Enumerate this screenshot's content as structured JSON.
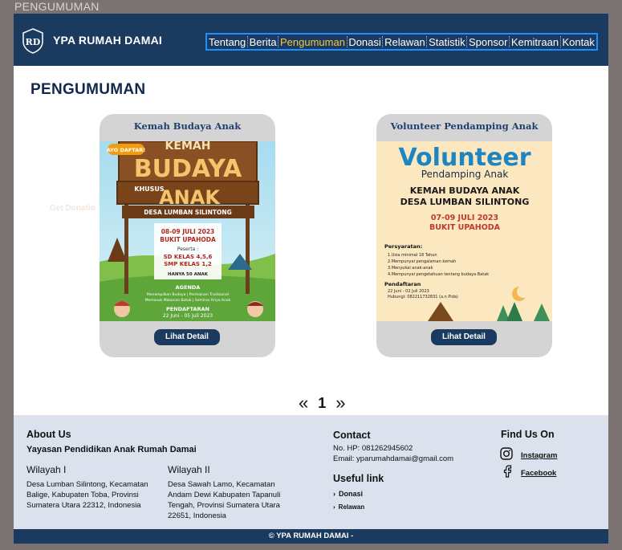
{
  "browser": {
    "tab_title": "PENGUMUMAN"
  },
  "header": {
    "brand": "YPA RUMAH DAMAI",
    "nav": [
      "Tentang",
      "Berita",
      "Pengumuman",
      "Donasi",
      "Relawan",
      "Statistik",
      "Sponsor",
      "Kemitraan",
      "Kontak"
    ],
    "active_nav": "Pengumuman"
  },
  "main": {
    "page_title": "PENGUMUMAN",
    "ghost_text": "Get Donatio",
    "cards": [
      {
        "title": "Kemah Budaya Anak",
        "button": "Lihat Detail",
        "poster": {
          "badge": "AYO DAFTAR!",
          "line1": "KEMAH",
          "line2": "BUDAYA",
          "line3_small": "KHUSUS",
          "line3": "ANAK",
          "place": "DESA LUMBAN SILINTONG",
          "date": "08-09 JULI 2023",
          "venue": "BUKIT UPAHODA",
          "peserta_label": "Peserta :",
          "peserta1": "SD KELAS 4,5,6",
          "peserta2": "SMP KELAS 1,2",
          "quota": "HANYA 50 ANAK",
          "agenda_label": "AGENDA",
          "agenda1": "Menampilkan Budaya | Permainan Tradisional",
          "agenda2": "Memasak Makanan Batak | Seminar Kriya Anak",
          "reg_label": "PENDAFTARAN",
          "reg_date": "22 Juni - 05 Juli 2023"
        }
      },
      {
        "title": "Volunteer Pendamping Anak",
        "button": "Lihat Detail",
        "poster": {
          "big": "Volunteer",
          "sub": "Pendamping Anak",
          "event1": "KEMAH BUDAYA ANAK",
          "event2": "DESA LUMBAN SILINTONG",
          "date": "07-09 JULI 2023",
          "venue": "BUKIT UPAHODA",
          "req_label": "Persyaratan:",
          "req": [
            "1.Usia minimal 18 Tahun",
            "2.Mempunyai pengalaman kemah",
            "3.Menyukai anak-anak",
            "4.Mempunyai pengetahuan tentang budaya Batak"
          ],
          "reg_label": "Pendaftaran",
          "reg_date": "22 Juni - 02 Juli 2023",
          "contact": "Hubungi: 082211732831 (a.n Pida)"
        }
      }
    ],
    "pagination": {
      "prev": "«",
      "current": "1",
      "next": "»"
    }
  },
  "footer": {
    "about_heading": "About Us",
    "org_name": "Yayasan Pendidikan Anak Rumah Damai",
    "regions": [
      {
        "name": "Wilayah I",
        "address": "Desa Lumban Silintong, Kecamatan Balige, Kabupaten Toba, Provinsi Sumatera Utara  22312, Indonesia"
      },
      {
        "name": "Wilayah II",
        "address": "Desa Sawah Lamo, Kecamatan Andam Dewi Kabupaten Tapanuli Tengah, Provinsi Sumatera Utara 22651, Indonesia"
      }
    ],
    "contact_heading": "Contact",
    "phone": "No. HP: 081262945602",
    "email": "Email: yparumahdamai@gmail.com",
    "useful_heading": "Useful link",
    "links": [
      "Donasi",
      "Relawan"
    ],
    "find_heading": "Find Us On",
    "social": [
      {
        "label": "Instagram",
        "icon": "instagram-icon"
      },
      {
        "label": "Facebook",
        "icon": "facebook-icon"
      }
    ],
    "copyright": "© YPA RUMAH DAMAI -"
  },
  "colors": {
    "navy": "#1b3a5f",
    "active_nav": "#f5c842",
    "footer_bg": "#dbe1ed",
    "card_bg": "#d5d4d4",
    "page_bg": "#7a7371"
  }
}
